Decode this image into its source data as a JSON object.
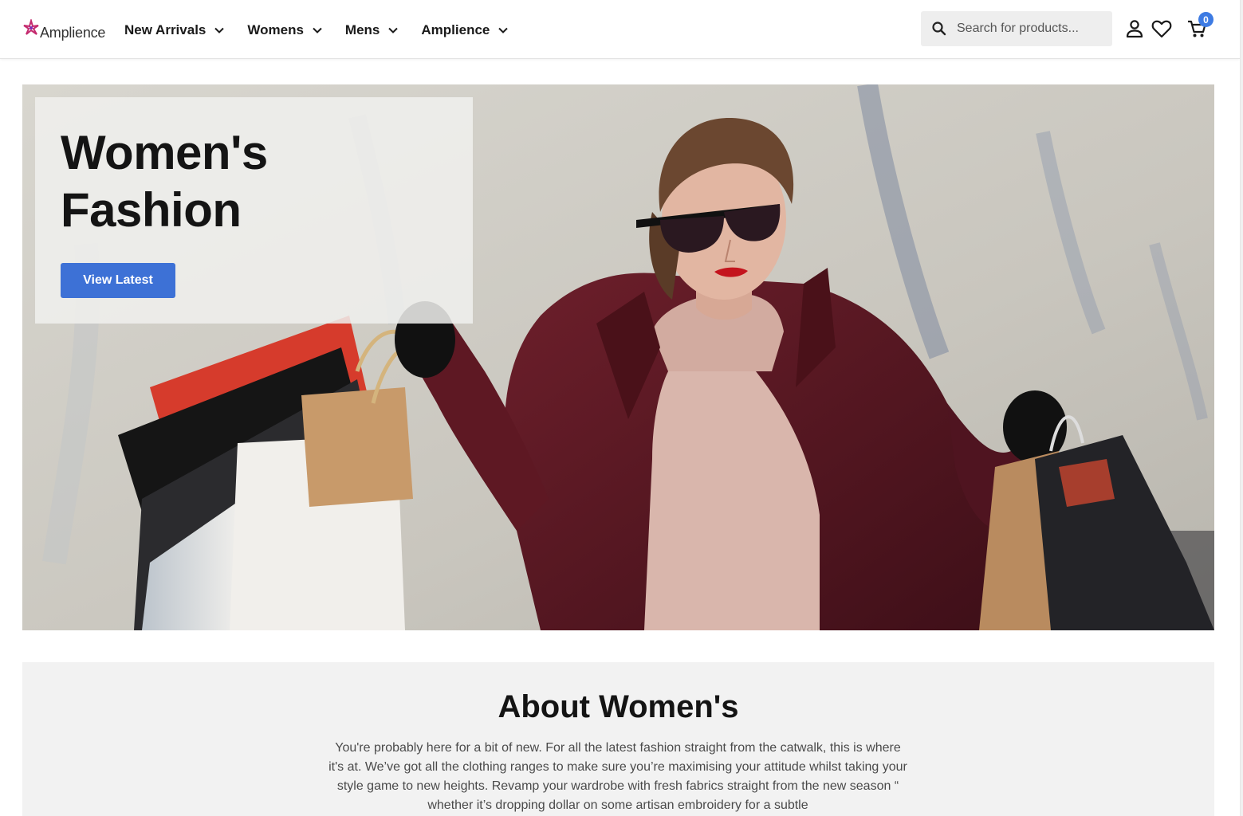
{
  "header": {
    "logo_text": "Amplience",
    "nav": [
      {
        "label": "New Arrivals"
      },
      {
        "label": "Womens"
      },
      {
        "label": "Mens"
      },
      {
        "label": "Amplience"
      }
    ],
    "search": {
      "placeholder": "Search for products..."
    },
    "icons": {
      "search": "search-icon",
      "account": "account-icon",
      "wishlist": "heart-icon",
      "cart": "cart-icon",
      "chevron": "chevron-down-icon"
    },
    "cart_count": "0"
  },
  "hero": {
    "title_line1": "Women's",
    "title_line2": "Fashion",
    "button_label": "View Latest",
    "image_alt": "hero-photo"
  },
  "about": {
    "title": "About Women's",
    "body": "You're probably here for a bit of new. For all the latest fashion straight from the catwalk, this is where it's at. We’ve got all the clothing ranges to make sure you’re maximising your attitude whilst taking your style game to new heights. Revamp your wardrobe with fresh fabrics straight from the new season “ whether it’s dropping dollar on some artisan embroidery for a subtle"
  },
  "colors": {
    "accent": "#3d71d6",
    "badge": "#3d7be3",
    "logo_brand": "#c42a6e",
    "coat": "#5a1a24"
  }
}
